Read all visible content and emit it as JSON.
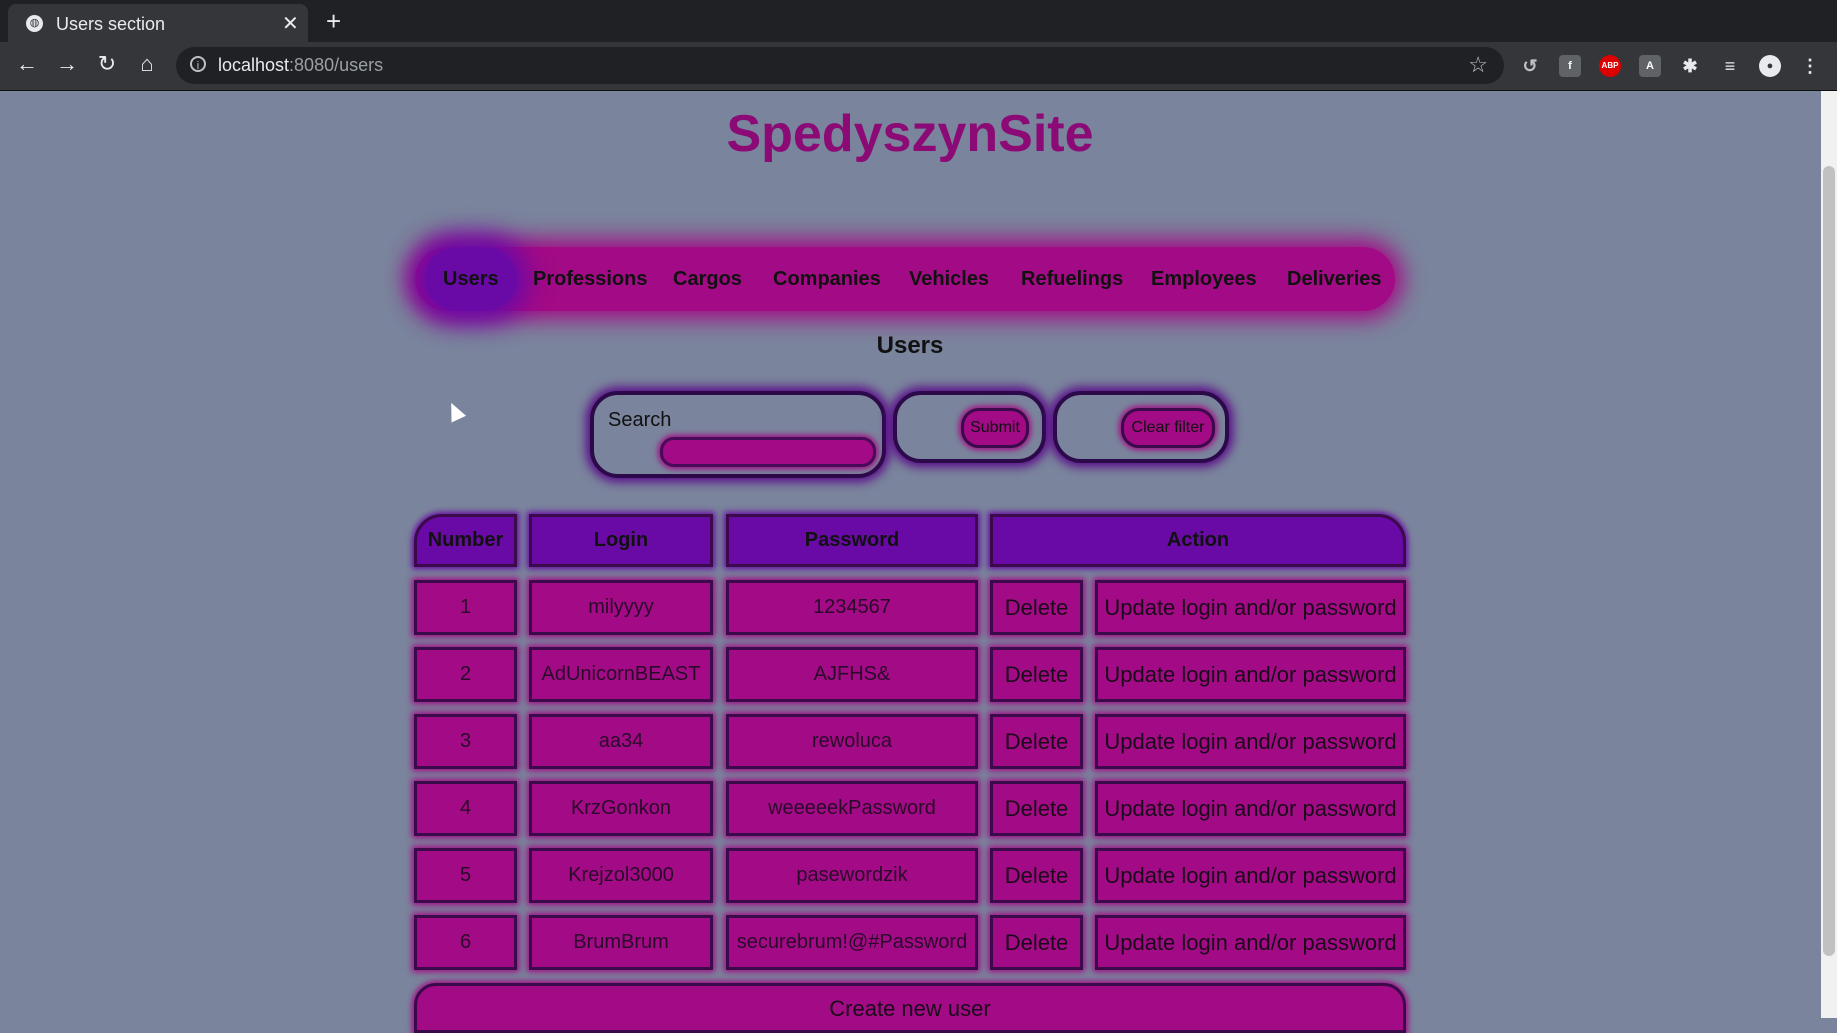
{
  "browser": {
    "tab_title": "Users section",
    "url_host": "localhost",
    "url_rest": ":8080/users"
  },
  "site": {
    "title": "SpedyszynSite"
  },
  "nav": {
    "items": [
      "Users",
      "Professions",
      "Cargos",
      "Companies",
      "Vehicles",
      "Refuelings",
      "Employees",
      "Deliveries"
    ],
    "active": "Users"
  },
  "section": {
    "title": "Users"
  },
  "filter": {
    "search_label": "Search",
    "search_value": "",
    "submit_label": "Submit",
    "clear_label": "Clear filter"
  },
  "table": {
    "headers": [
      "Number",
      "Login",
      "Password",
      "Action"
    ],
    "rows": [
      {
        "number": "1",
        "login": "milyyyy",
        "password": "1234567"
      },
      {
        "number": "2",
        "login": "AdUnicornBEAST",
        "password": "AJFHS&"
      },
      {
        "number": "3",
        "login": "aa34",
        "password": "rewoluca"
      },
      {
        "number": "4",
        "login": "KrzGonkon",
        "password": "weeeeekPassword"
      },
      {
        "number": "5",
        "login": "Krejzol3000",
        "password": "pasewordzik"
      },
      {
        "number": "6",
        "login": "BrumBrum",
        "password": "securebrum!@#Password"
      }
    ],
    "delete_label": "Delete",
    "update_label": "Update login and/or password",
    "create_label": "Create new user"
  },
  "colors": {
    "page_bg": "#7a849c",
    "magenta": "#a30a85",
    "purple": "#6a0aa6",
    "title": "#8b0a75"
  }
}
